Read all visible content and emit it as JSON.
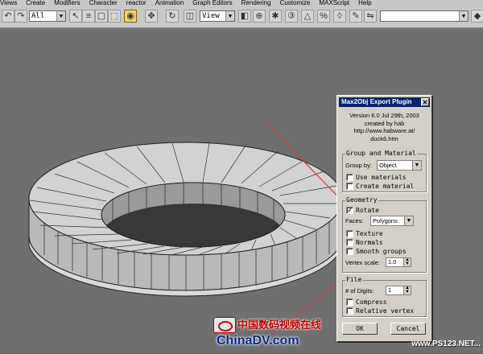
{
  "menubar": {
    "items": [
      "Views",
      "Create",
      "Modifiers",
      "Character",
      "reactor",
      "Animation",
      "Graph Editors",
      "Rendering",
      "Customize",
      "MAXScript",
      "Help"
    ]
  },
  "toolbar": {
    "selection_filter": "All",
    "reference_coord": "View",
    "accent_color": "#f1d26a"
  },
  "dialog": {
    "title": "Max2Obj Export Plugin",
    "close_icon": "close-icon",
    "version": "Version 6.0 Jul 29th, 2003",
    "created_by": "created by hab",
    "url_line1": "http://www.habware.at/",
    "url_line2": "duck6.htm",
    "group_material": {
      "legend": "Group and Material",
      "group_by_label": "Group by:",
      "group_by_value": "Object",
      "use_materials": "Use materials",
      "use_materials_checked": false,
      "create_material": "Create material",
      "create_material_checked": false
    },
    "geometry": {
      "legend": "Geometry",
      "rotate": "Rotate",
      "rotate_checked": true,
      "faces_label": "Faces:",
      "faces_value": "Polygons",
      "texture": "Texture",
      "texture_checked": false,
      "normals": "Normals",
      "normals_checked": false,
      "smooth_groups": "Smooth groups",
      "smooth_groups_checked": false,
      "vertex_scale_label": "Vertex scale:",
      "vertex_scale_value": "1.0"
    },
    "file": {
      "legend": "File",
      "digits_label": "# of Digits:",
      "digits_value": "1",
      "compress": "Compress",
      "compress_checked": false,
      "relative_vertex": "Relative vertex",
      "relative_vertex_checked": false
    },
    "ok_label": "OK",
    "cancel_label": "Cancel"
  },
  "watermark": {
    "logo_cn": "中国数码视频在线",
    "logo_en": "ChinaDV.com",
    "site": "www.PS123.NET..."
  }
}
